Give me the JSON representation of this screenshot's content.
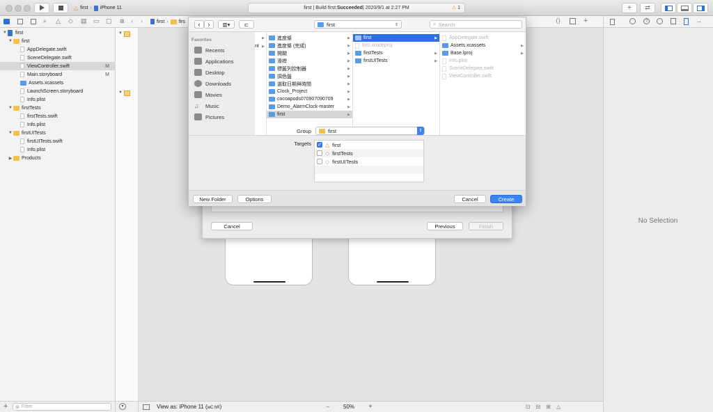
{
  "toolbar": {
    "scheme_target": "first",
    "scheme_device": "iPhone 11",
    "status_prefix": "first | Build first: ",
    "status_result": "Succeeded",
    "status_date": " | 2020/9/1 at 2:27 PM",
    "warning_count": "1"
  },
  "navigator": {
    "rows": [
      {
        "label": "first"
      },
      {
        "label": "first"
      },
      {
        "label": "AppDelegate.swift"
      },
      {
        "label": "SceneDelegate.swift"
      },
      {
        "label": "ViewController.swift",
        "badge": "M"
      },
      {
        "label": "Main.storyboard",
        "badge": "M"
      },
      {
        "label": "Assets.xcassets"
      },
      {
        "label": "LaunchScreen.storyboard"
      },
      {
        "label": "Info.plist"
      },
      {
        "label": "firstTests"
      },
      {
        "label": "firstTests.swift"
      },
      {
        "label": "Info.plist"
      },
      {
        "label": "firstUITests"
      },
      {
        "label": "firstUITests.swift"
      },
      {
        "label": "Info.plist"
      },
      {
        "label": "Products"
      }
    ],
    "filter_placeholder": "Filter"
  },
  "jumpbar": {
    "crumb1": "first",
    "crumb2": "firs"
  },
  "dialog": {
    "location": "first",
    "search_placeholder": "Search",
    "favorites_header": "Favorites",
    "favorites": [
      "Recents",
      "Applications",
      "Desktop",
      "Downloads",
      "Movies",
      "Music",
      "Pictures"
    ],
    "col0_partial": "nt",
    "col1": [
      "進度條",
      "進度條 (完成)",
      "開關",
      "滑桿",
      "標籤列控制器",
      "調色盤",
      "選取日期與時間",
      "Clock_Project",
      "cocoapods070907090709",
      "Demo_AlarmClock-master",
      "first"
    ],
    "col2": [
      "first",
      "first.xcodeproj",
      "firstTests",
      "firstUITests"
    ],
    "col3": [
      "AppDelegate.swift",
      "Assets.xcassets",
      "Base.lproj",
      "Info.plist",
      "SceneDelegate.swift",
      "ViewController.swift"
    ],
    "group_label": "Group",
    "group_value": "first",
    "targets_label": "Targets",
    "targets": [
      "first",
      "firstTests",
      "firstUITests"
    ],
    "new_folder": "New Folder",
    "options": "Options",
    "cancel": "Cancel",
    "create": "Create"
  },
  "back_sheet": {
    "cancel": "Cancel",
    "previous": "Previous",
    "finish": "Finish"
  },
  "editor_bottom": {
    "view_as": "View as: iPhone 11 (",
    "traits": "wC hR",
    "view_as_close": ")",
    "zoom": "50%"
  },
  "inspector": {
    "empty": "No Selection"
  },
  "colors": {
    "accent": "#3b82f2",
    "selection": "#2d6fe0",
    "folder": "#f2c14c"
  }
}
